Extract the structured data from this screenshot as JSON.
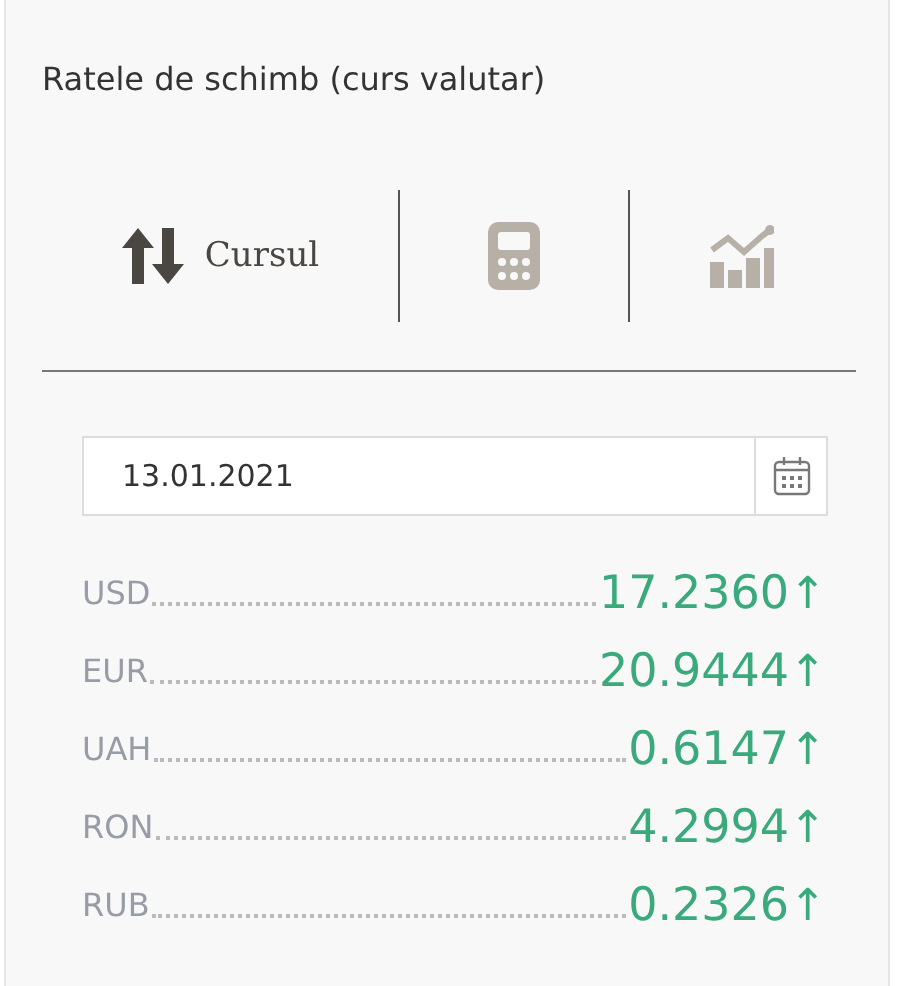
{
  "title": "Ratele de schimb (curs valutar)",
  "tabs": [
    {
      "kind": "arrows",
      "label": "Cursul",
      "selected": true
    },
    {
      "kind": "calculator",
      "selected": false
    },
    {
      "kind": "chart",
      "selected": false
    }
  ],
  "date_field": {
    "value": "13.01.2021"
  },
  "rates": [
    {
      "code": "USD",
      "value": "17.2360",
      "trend": "↑"
    },
    {
      "code": "EUR",
      "value": "20.9444",
      "trend": "↑"
    },
    {
      "code": "UAH",
      "value": "0.6147",
      "trend": "↑"
    },
    {
      "code": "RON",
      "value": "4.2994",
      "trend": "↑"
    },
    {
      "code": "RUB",
      "value": "0.2326",
      "trend": "↑"
    }
  ]
}
